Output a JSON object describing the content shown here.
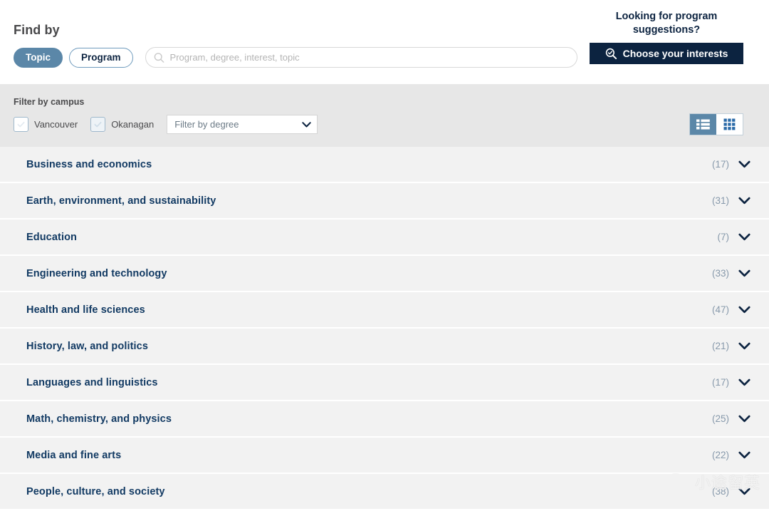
{
  "header": {
    "find_by_label": "Find by",
    "tabs": [
      {
        "label": "Topic",
        "active": true
      },
      {
        "label": "Program",
        "active": false
      }
    ],
    "search": {
      "placeholder": "Program, degree, interest, topic",
      "value": "",
      "icon": "search-icon"
    },
    "suggestions": {
      "title": "Looking for program suggestions?",
      "button_label": "Choose your interests",
      "button_icon": "search-check-icon",
      "button_color": "#0c2340"
    }
  },
  "filters": {
    "campus_label": "Filter by campus",
    "checkboxes": [
      {
        "label": "Vancouver",
        "checked": false
      },
      {
        "label": "Okanagan",
        "checked": false
      }
    ],
    "degree_select": {
      "selected": "Filter by degree",
      "options": [
        "Filter by degree"
      ]
    },
    "view_toggle": {
      "list_icon": "list-view-icon",
      "grid_icon": "grid-view-icon",
      "active": "list"
    }
  },
  "topics": [
    {
      "name": "Business and economics",
      "count": "(17)"
    },
    {
      "name": "Earth, environment, and sustainability",
      "count": "(31)"
    },
    {
      "name": "Education",
      "count": "(7)"
    },
    {
      "name": "Engineering and technology",
      "count": "(33)"
    },
    {
      "name": "Health and life sciences",
      "count": "(47)"
    },
    {
      "name": "History, law, and politics",
      "count": "(21)"
    },
    {
      "name": "Languages and linguistics",
      "count": "(17)"
    },
    {
      "name": "Math, chemistry, and physics",
      "count": "(25)"
    },
    {
      "name": "Media and fine arts",
      "count": "(22)"
    },
    {
      "name": "People, culture, and society",
      "count": "(38)"
    }
  ],
  "watermark": {
    "text": "小途留英",
    "icon": "wechat-icon"
  },
  "colors": {
    "accent_blue": "#5b87a8",
    "navy": "#0c2340",
    "topic_text": "#123a63",
    "filter_bg": "#e7e7e7",
    "row_bg": "#f2f2f2"
  }
}
